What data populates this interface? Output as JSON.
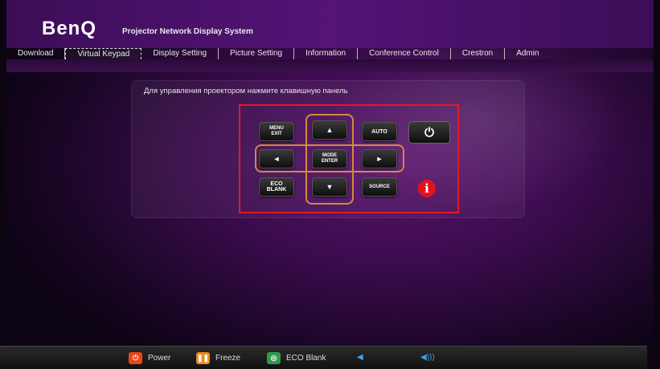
{
  "header": {
    "logo": "BenQ",
    "subtitle": "Projector Network Display System"
  },
  "nav": {
    "items": [
      "Download",
      "Virtual Keypad",
      "Display Setting",
      "Picture Setting",
      "Information",
      "Conference Control",
      "Crestron",
      "Admin"
    ],
    "active": "Virtual Keypad"
  },
  "main": {
    "instruction": "Для управления проектором нажмите клавишную панель",
    "keys": {
      "menu_line1": "MENU",
      "menu_line2": "EXIT",
      "up_arrow": "▲",
      "auto": "AUTO",
      "left_arrow": "◄",
      "mode_line1": "MODE",
      "mode_line2": "ENTER",
      "right_arrow": "►",
      "eco_line1": "ECO",
      "eco_line2": "BLANK",
      "down_arrow": "▼",
      "source": "SOURCE",
      "power_symbol": "⏻"
    },
    "info_icon": "i",
    "highlight_color": "#e01a26"
  },
  "footer": {
    "power_label": "Power",
    "freeze_label": "Freeze",
    "eco_label": "ECO Blank",
    "power_color": "#e8471c",
    "freeze_color": "#f08a1a",
    "eco_color": "#2e9a4a",
    "icons": [
      "power-icon",
      "freeze-icon",
      "eco-blank-icon",
      "volume-down-icon",
      "volume-up-icon"
    ]
  }
}
